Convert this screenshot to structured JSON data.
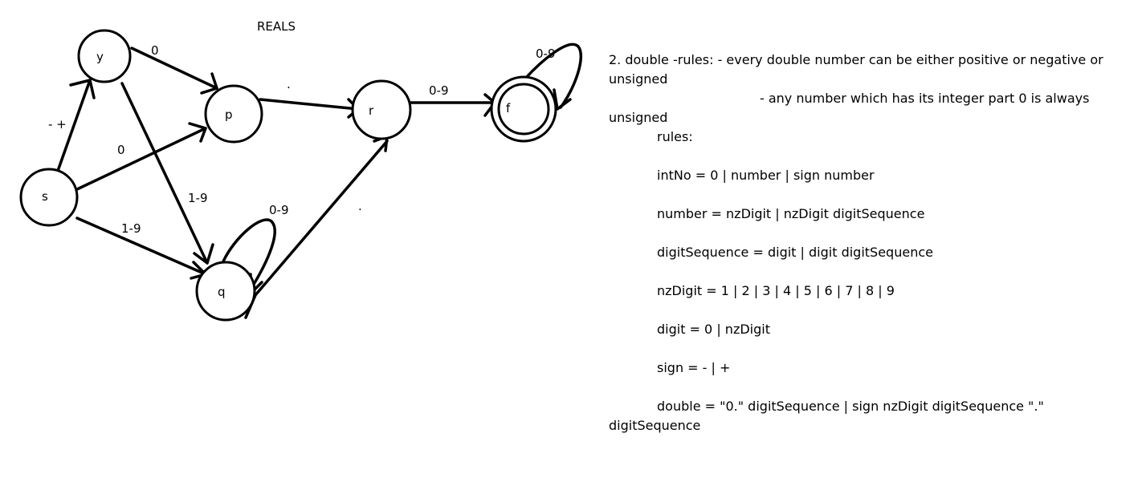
{
  "title": "REALS",
  "states": {
    "s": "s",
    "y": "y",
    "p": "p",
    "q": "q",
    "r": "r",
    "f": "f"
  },
  "edge_labels": {
    "s_y": "- +",
    "y_p": "0",
    "s_p": "0",
    "y_q": "1-9",
    "s_q": "1-9",
    "q_loop": "0-9",
    "p_r": ".",
    "q_r": ".",
    "r_f": "0-9",
    "f_loop": "0-9"
  },
  "rules_text": {
    "line1": "2. double -rules: - every double number can be either positive or negative or unsigned",
    "line2": "- any number which has its integer part 0 is always unsigned",
    "rules_label": "rules:",
    "intNo": "intNo = 0 | number | sign number",
    "number": "number = nzDigit | nzDigit digitSequence",
    "digitSequence": "digitSequence = digit | digit digitSequence",
    "nzDigit": "nzDigit = 1 | 2 | 3 | 4 | 5 | 6 | 7 | 8 | 9",
    "digit": "digit = 0 | nzDigit",
    "sign": "sign = - | +",
    "double": "double = \"0.\" digitSequence | sign nzDigit digitSequence \".\" digitSequence"
  }
}
